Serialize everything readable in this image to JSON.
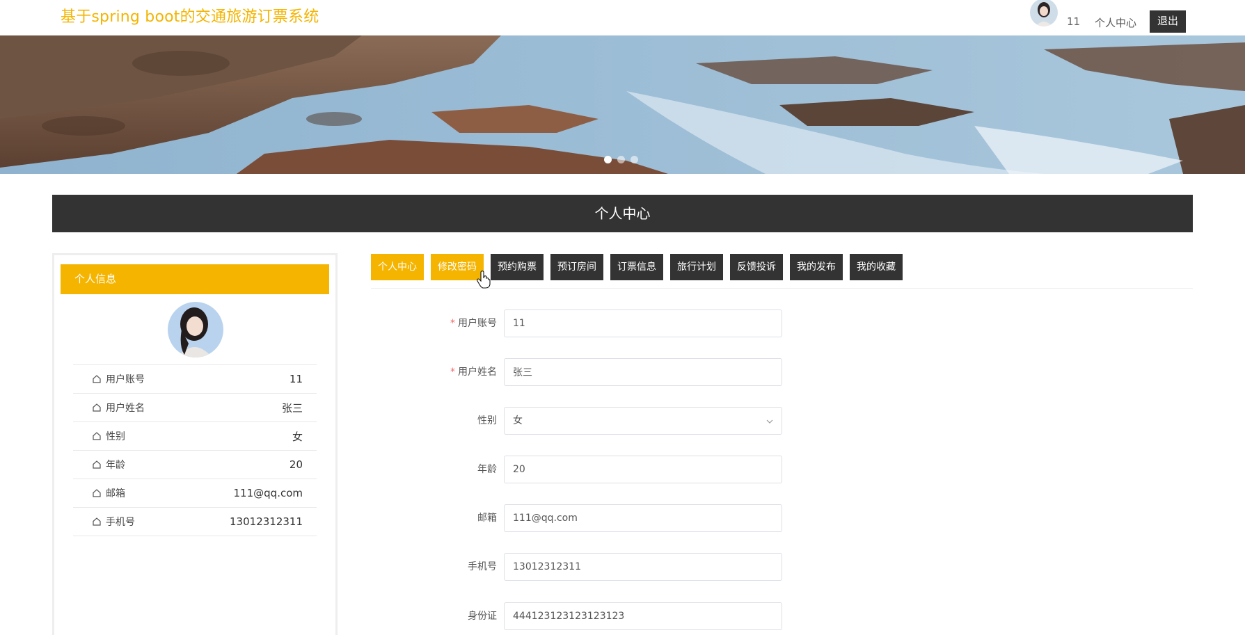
{
  "header": {
    "site_title": "基于spring boot的交通旅游订票系统",
    "username": "11",
    "center_link": "个人中心",
    "logout_label": "退出"
  },
  "banner": {
    "slide_count": 3,
    "active_slide": 1
  },
  "section_title": "个人中心",
  "profile_panel": {
    "title": "个人信息",
    "rows": [
      {
        "label": "用户账号",
        "value": "11"
      },
      {
        "label": "用户姓名",
        "value": "张三"
      },
      {
        "label": "性别",
        "value": "女"
      },
      {
        "label": "年龄",
        "value": "20"
      },
      {
        "label": "邮箱",
        "value": "111@qq.com"
      },
      {
        "label": "手机号",
        "value": "13012312311"
      }
    ]
  },
  "tabs": [
    {
      "label": "个人中心",
      "active": true
    },
    {
      "label": "修改密码",
      "active": true
    },
    {
      "label": "预约购票",
      "active": false
    },
    {
      "label": "预订房间",
      "active": false
    },
    {
      "label": "订票信息",
      "active": false
    },
    {
      "label": "旅行计划",
      "active": false
    },
    {
      "label": "反馈投诉",
      "active": false
    },
    {
      "label": "我的发布",
      "active": false
    },
    {
      "label": "我的收藏",
      "active": false
    }
  ],
  "form": {
    "required_mark": "*",
    "fields": [
      {
        "label": "用户账号",
        "value": "11",
        "required": true,
        "type": "text"
      },
      {
        "label": "用户姓名",
        "value": "张三",
        "required": true,
        "type": "text"
      },
      {
        "label": "性别",
        "value": "女",
        "required": false,
        "type": "select"
      },
      {
        "label": "年龄",
        "value": "20",
        "required": false,
        "type": "text"
      },
      {
        "label": "邮箱",
        "value": "111@qq.com",
        "required": false,
        "type": "text"
      },
      {
        "label": "手机号",
        "value": "13012312311",
        "required": false,
        "type": "text"
      },
      {
        "label": "身份证",
        "value": "444123123123123123",
        "required": false,
        "type": "text"
      }
    ]
  },
  "colors": {
    "accent": "#f4b400",
    "dark": "#333333",
    "required": "#f56c6c"
  }
}
